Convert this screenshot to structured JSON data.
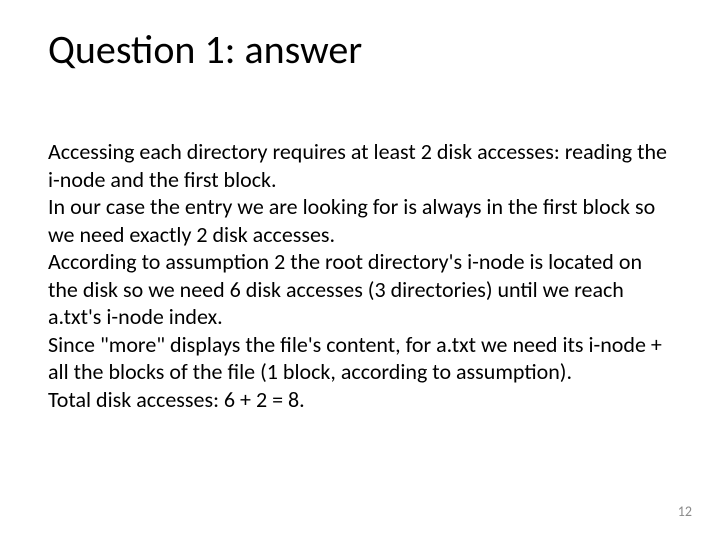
{
  "slide": {
    "title": "Question 1: answer",
    "body": "Accessing each directory requires at least 2 disk accesses: reading the i-node and the first block.\nIn our case the entry we are looking for is always in the first block so we need exactly 2 disk accesses.\nAccording to assumption 2 the root directory's  i-node is located on the disk so we need 6 disk accesses (3 directories) until we reach a.txt's i-node index.\nSince \"more\" displays the file's content, for a.txt we need its i-node + all the blocks of the file (1 block, according to assumption).\nTotal disk accesses: 6 + 2 = 8.",
    "page_number": "12"
  }
}
